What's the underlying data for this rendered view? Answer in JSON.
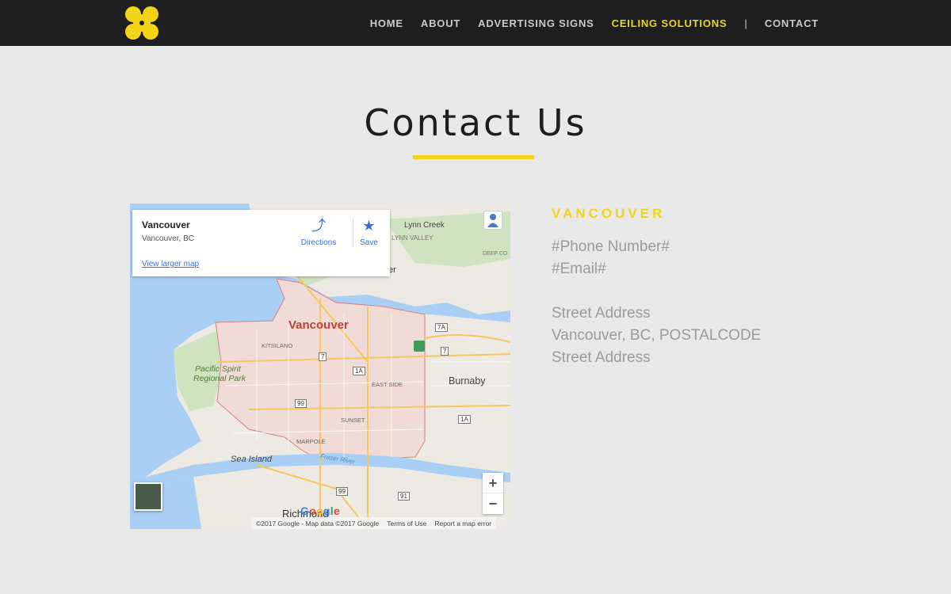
{
  "header": {
    "logo": "logo-icon",
    "nav": [
      {
        "label": "HOME",
        "active": false
      },
      {
        "label": "ABOUT",
        "active": false
      },
      {
        "label": "ADVERTISING SIGNS",
        "active": false
      },
      {
        "label": "CEILING SOLUTIONS",
        "active": true
      },
      {
        "label": "|",
        "separator": true
      },
      {
        "label": "CONTACT",
        "active": false
      }
    ]
  },
  "page": {
    "title": "Contact Us"
  },
  "map": {
    "infocard": {
      "title": "Vancouver",
      "subtitle": "Vancouver, BC",
      "link": "View larger map",
      "directions": "Directions",
      "save": "Save"
    },
    "labels": {
      "vancouver": "Vancouver",
      "lynn_creek": "Lynn Creek",
      "lynn_valley": "LYNN VALLEY",
      "deep_cove": "DEEP CO",
      "kitsilano": "KITSILANO",
      "pacific_spirit_1": "Pacific Spirit",
      "pacific_spirit_2": "Regional Park",
      "east_side": "EAST SIDE",
      "burnaby": "Burnaby",
      "sunset": "SUNSET",
      "marpole": "MARPOLE",
      "sea_island": "Sea Island",
      "fraser_river": "Fraser River",
      "richmond": "Richmond",
      "partial_er": "er"
    },
    "shields": [
      "7A",
      "7",
      "1A",
      "99",
      "7",
      "1A",
      "99",
      "91"
    ],
    "attribution": "©2017 Google - Map data ©2017 Google",
    "terms": "Terms of Use",
    "report": "Report a map error",
    "zoom_in": "+",
    "zoom_out": "−",
    "google_logo": [
      "G",
      "o",
      "o",
      "g",
      "l",
      "e"
    ]
  },
  "contact": {
    "city": "VANCOUVER",
    "phone": "#Phone Number#",
    "email": "#Email#",
    "address_line1": "Street Address",
    "address_line2": "Vancouver, BC, POSTALCODE",
    "address_line3": "Street Address"
  },
  "colors": {
    "accent": "#f3d416",
    "header_bg": "#1e1e1e",
    "page_bg": "#e8e9e8",
    "text_gray": "#9b9b9b"
  }
}
